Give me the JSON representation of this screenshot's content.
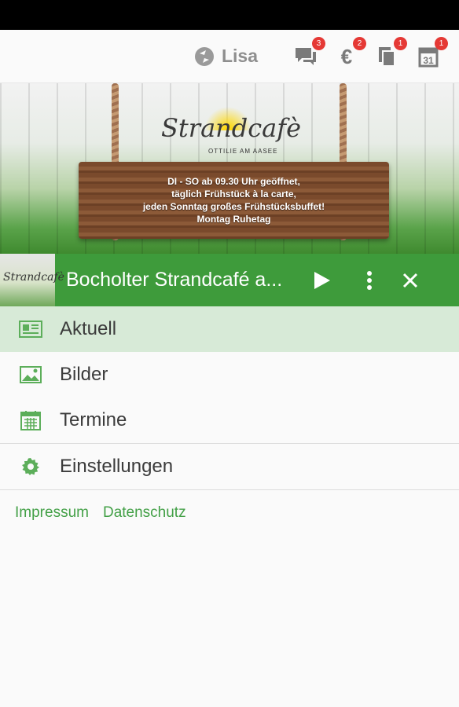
{
  "topbar": {
    "user_name": "Lisa",
    "icons": [
      {
        "name": "chat-icon",
        "badge": "3"
      },
      {
        "name": "euro-icon",
        "glyph": "€",
        "badge": "2"
      },
      {
        "name": "documents-icon",
        "badge": "1"
      },
      {
        "name": "calendar-icon",
        "glyph": "31",
        "badge": "1"
      }
    ]
  },
  "banner": {
    "logo_text": "Strandcafè",
    "logo_sub": "OTTILIE AM AASEE",
    "sign_lines": [
      "DI - SO ab 09.30 Uhr geöffnet,",
      "täglich Frühstück à la carte,",
      "jeden Sonntag großes Frühstücksbuffet!",
      "Montag Ruhetag"
    ]
  },
  "header": {
    "thumb_text": "Strandcafè",
    "title": "Bocholter Strandcafé a..."
  },
  "menu": {
    "items": [
      {
        "label": "Aktuell",
        "icon": "news-icon",
        "active": true
      },
      {
        "label": "Bilder",
        "icon": "image-icon"
      },
      {
        "label": "Termine",
        "icon": "calendar-icon"
      },
      {
        "label": "Einstellungen",
        "icon": "gear-icon"
      }
    ]
  },
  "footer": {
    "links": [
      "Impressum",
      "Datenschutz"
    ]
  },
  "colors": {
    "accent": "#3e9b3b",
    "active_row": "#d7ead7",
    "link": "#43a047",
    "badge": "#e53935"
  }
}
